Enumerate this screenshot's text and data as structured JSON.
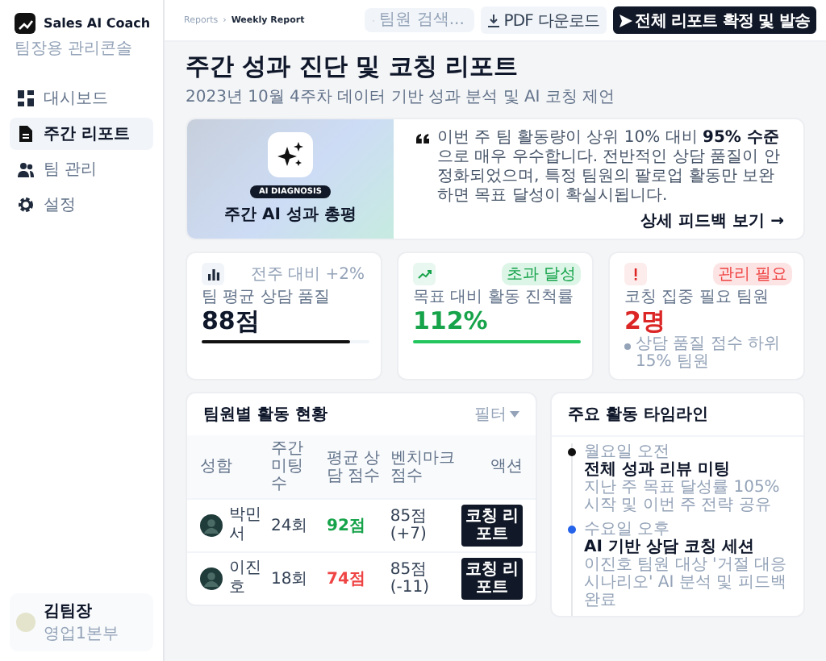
{
  "sidebar": {
    "brand": "Sales AI Coach",
    "subtitle": "팀장용 관리콘솔",
    "items": [
      {
        "label": "대시보드",
        "selected": false
      },
      {
        "label": "주간 리포트",
        "selected": true
      },
      {
        "label": "팀 관리",
        "selected": false
      },
      {
        "label": "설정",
        "selected": false
      }
    ],
    "user": {
      "name": "김팀장",
      "team": "영업1본부"
    }
  },
  "topbar": {
    "breadcrumb": [
      "Reports",
      "›",
      "Weekly Report"
    ],
    "search": {
      "placeholder": "팀원 검색..."
    },
    "pdf_button": "PDF 다운로드",
    "primary_button": "전체 리포트 확정 및 발송"
  },
  "page": {
    "title": "주간 성과 진단 및 코칭 리포트",
    "subtitle": "2023년 10월 4주차 데이터 기반 성과 분석 및 AI 코칭 제언"
  },
  "hero": {
    "badge": "AI DIAGNOSIS",
    "title": "주간 AI 성과 총평",
    "quote": "이번 주 팀 활동량이 상위 10% 대비 **95% 수준**으로 매우 우수합니다. 전반적인 상담 품질이 안정화되었으며, 특정 팀원의 팔로업 활동만 보완하면 목표 달성이 확실시됩니다.",
    "link": "상세 피드백 보기 →"
  },
  "stats": [
    {
      "kind": "quality",
      "badge": "전주 대비 +2%",
      "label": "팀 평균 상담 품질",
      "value": "88점",
      "level": 0.88
    },
    {
      "kind": "progress",
      "badge": "초과 달성",
      "label": "목표 대비 활동 진척률",
      "value": "112%",
      "level": 1.0
    },
    {
      "kind": "alert",
      "badge": "관리 필요",
      "label": "코칭 집중 필요 팀원",
      "value": "2명",
      "note": "상담 품질 점수 하위 15% 팀원"
    }
  ],
  "table": {
    "title": "팀원별 활동 현황",
    "filter": "필터",
    "columns": [
      "성함",
      "주간 미팅 수",
      "평균 상담 점수",
      "벤치마크 점수",
      "액션"
    ],
    "rows": [
      {
        "name": "박민서",
        "meetings": "24회",
        "score": {
          "text": "92점",
          "color": "#16a34a"
        },
        "benchmark": "85점 (+7)",
        "action": "코칭 리포트"
      },
      {
        "name": "이진호",
        "meetings": "18회",
        "score": {
          "text": "74점",
          "color": "#ef4444"
        },
        "benchmark": "85점 (-11)",
        "action": "코칭 리포트"
      }
    ]
  },
  "timeline": {
    "title": "주요 활동 타임라인",
    "items": [
      {
        "time": "월요일 오전",
        "title": "전체 성과 리뷰 미팅",
        "desc": "지난 주 목표 달성률 105% 시작 및 이번 주 전략 공유",
        "color": "#111111"
      },
      {
        "time": "수요일 오후",
        "title": "AI 기반 상담 코칭 세션",
        "desc": "이진호 팀원 대상 '거절 대응 시나리오' AI 분석 및 피드백 완료",
        "color": "#2563eb"
      }
    ]
  }
}
